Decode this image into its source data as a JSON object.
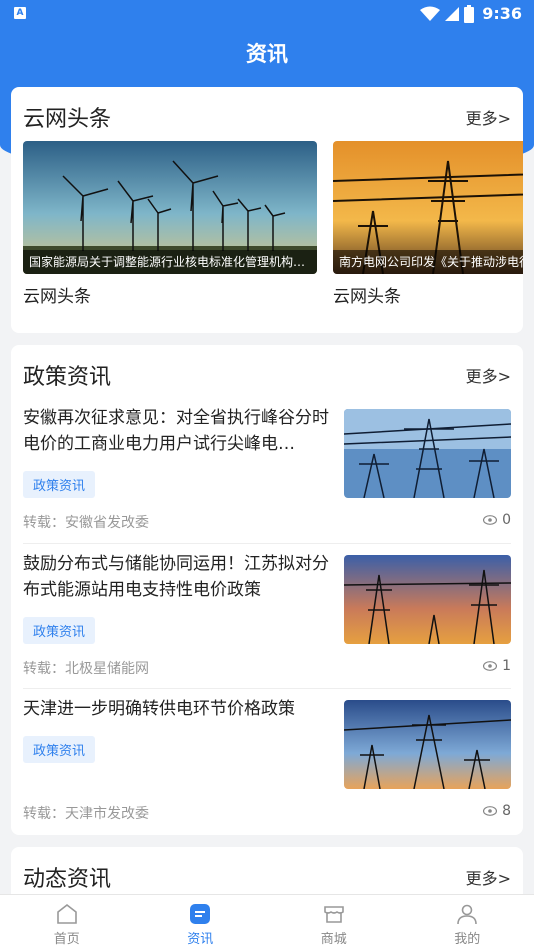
{
  "status_bar": {
    "time": "9:36",
    "notification_icon": "a-icon"
  },
  "header": {
    "title": "资讯"
  },
  "section_headlines": {
    "title": "云网头条",
    "more": "更多>",
    "items": [
      {
        "caption": "国家能源局关于调整能源行业核电标准化管理机构的通知",
        "label": "云网头条",
        "image": "wind-turbines-image"
      },
      {
        "caption": "南方电网公司印发《关于推动涉电行业高质量发展的意见》",
        "label": "云网头条",
        "image": "power-tower-image"
      }
    ]
  },
  "section_policy": {
    "title": "政策资讯",
    "more": "更多>",
    "items": [
      {
        "title": "安徽再次征求意见：对全省执行峰谷分时电价的工商业电力用户试行尖峰电…",
        "tag": "政策资讯",
        "source": "转载：安徽省发改委",
        "views": "0"
      },
      {
        "title": "鼓励分布式与储能协同运用！江苏拟对分布式能源站用电支持性电价政策",
        "tag": "政策资讯",
        "source": "转载：北极星储能网",
        "views": "1"
      },
      {
        "title": "天津进一步明确转供电环节价格政策",
        "tag": "政策资讯",
        "source": "转载：天津市发改委",
        "views": "8"
      }
    ]
  },
  "section_dynamic": {
    "title": "动态资讯",
    "more": "更多>"
  },
  "tabbar": {
    "tabs": [
      {
        "label": "首页",
        "icon": "home-icon"
      },
      {
        "label": "资讯",
        "icon": "news-icon"
      },
      {
        "label": "商城",
        "icon": "store-icon"
      },
      {
        "label": "我的",
        "icon": "user-icon"
      }
    ],
    "active_index": 1
  },
  "colors": {
    "primary": "#2f80ed",
    "tag_bg": "#e8f1fd"
  }
}
